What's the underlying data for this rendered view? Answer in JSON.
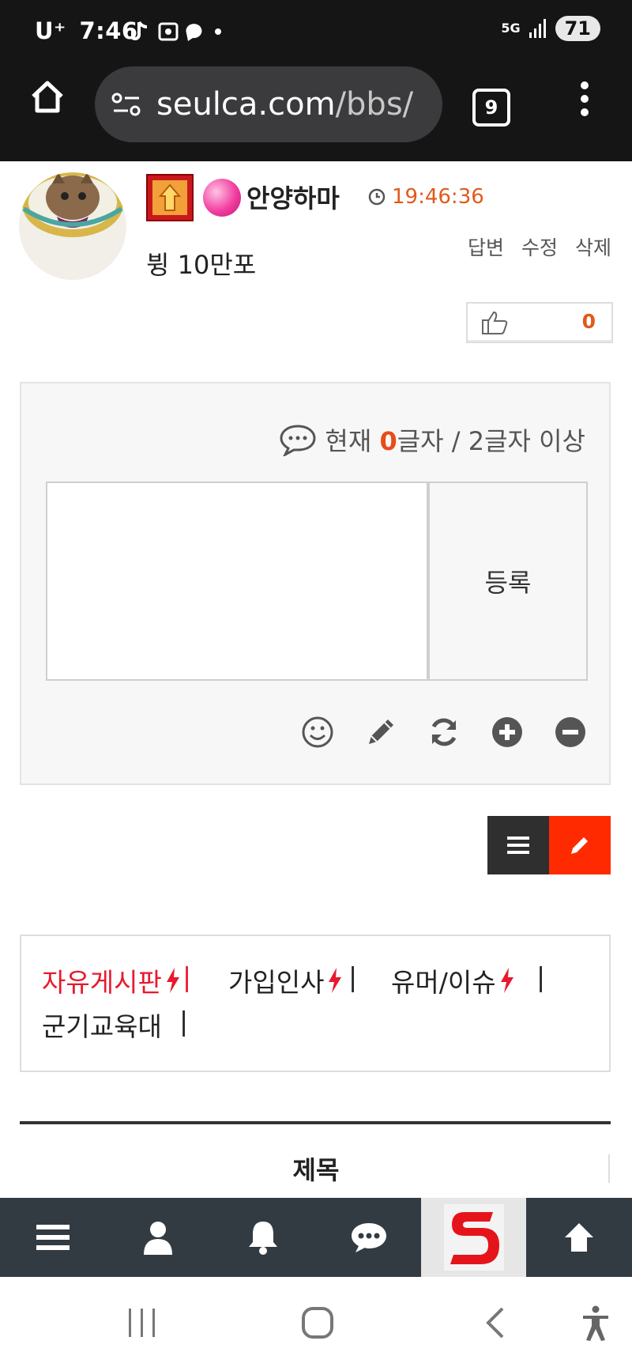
{
  "status_bar": {
    "carrier": "U⁺",
    "time": "7:46",
    "network": "5G",
    "battery": "71"
  },
  "browser": {
    "url_domain": "seulca.com",
    "url_path": "/bbs/",
    "tab_count": "9"
  },
  "post": {
    "author": "안양하마",
    "time": "19:46:36",
    "actions": [
      "답변",
      "수정",
      "삭제"
    ],
    "content": "뷩 10만포",
    "like_count": "0"
  },
  "comment": {
    "count_prefix": "현재 ",
    "count_value": "0",
    "count_suffix": "글자 / 2글자 이상",
    "submit_label": "등록"
  },
  "boards": [
    {
      "label": "자유게시판",
      "color": "#e8192c"
    },
    {
      "label": "가입인사",
      "color": "#222222"
    },
    {
      "label": "유머/이슈",
      "color": "#222222"
    },
    {
      "label": "군기교육대",
      "color": "#222222"
    }
  ],
  "table": {
    "column_title": "제목"
  },
  "colors": {
    "accent": "#ff2a00",
    "time": "#e05a1c",
    "bottom_bar": "#333b42"
  }
}
